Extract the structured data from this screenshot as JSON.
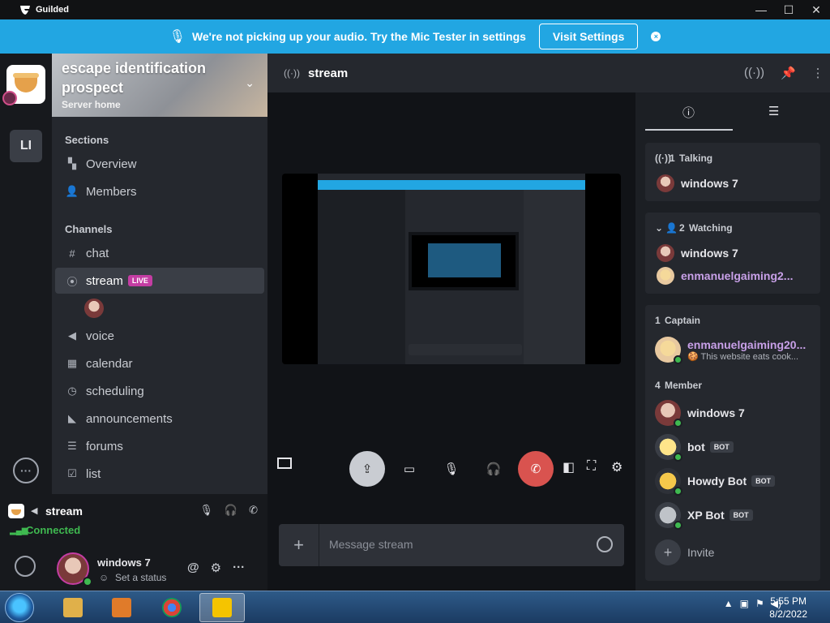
{
  "window": {
    "app_title": "Guilded",
    "minimize": "—",
    "maximize": "☐",
    "close": "✕"
  },
  "banner": {
    "message": "We're not picking up your audio. Try the Mic Tester in settings",
    "button": "Visit Settings",
    "close": "×"
  },
  "server": {
    "name": "escape identification prospect",
    "subtitle": "Server home",
    "rail_label": "LI"
  },
  "sidebar": {
    "sections_label": "Sections",
    "sections": [
      {
        "label": "Overview",
        "icon": "overview-icon"
      },
      {
        "label": "Members",
        "icon": "members-icon"
      }
    ],
    "channels_label": "Channels",
    "channels": [
      {
        "label": "chat",
        "icon": "hash-icon",
        "glyph": "#"
      },
      {
        "label": "stream",
        "icon": "stream-icon",
        "glyph": "((·))",
        "live": "LIVE"
      },
      {
        "label": "voice",
        "icon": "speaker-icon",
        "glyph": "🔈"
      },
      {
        "label": "calendar",
        "icon": "calendar-icon",
        "glyph": "▦"
      },
      {
        "label": "scheduling",
        "icon": "clock-icon",
        "glyph": "◷"
      },
      {
        "label": "announcements",
        "icon": "megaphone-icon",
        "glyph": "📢"
      },
      {
        "label": "forums",
        "icon": "forums-icon",
        "glyph": "☰"
      },
      {
        "label": "list",
        "icon": "checklist-icon",
        "glyph": "☑"
      }
    ]
  },
  "voice_panel": {
    "channel": "stream",
    "status": "Connected"
  },
  "user_panel": {
    "name": "windows 7",
    "status_placeholder": "Set a status"
  },
  "main": {
    "channel_title": "stream",
    "composer_placeholder": "Message stream",
    "plus": "+"
  },
  "right_panel": {
    "talking": {
      "count": "1",
      "label": "Talking",
      "members": [
        "windows 7"
      ]
    },
    "watching": {
      "count": "2",
      "label": "Watching",
      "members": [
        "windows 7",
        "enmanuelgaiming2..."
      ]
    },
    "captain": {
      "count": "1",
      "label": "Captain",
      "name": "enmanuelgaiming20...",
      "status": "🍪 This website eats cook..."
    },
    "member": {
      "count": "4",
      "label": "Member",
      "items": [
        {
          "name": "windows 7",
          "badge": ""
        },
        {
          "name": "bot",
          "badge": "BOT"
        },
        {
          "name": "Howdy Bot",
          "badge": "BOT"
        },
        {
          "name": "XP Bot",
          "badge": "BOT"
        }
      ]
    },
    "invite": "Invite"
  },
  "taskbar": {
    "time": "5:55 PM",
    "date": "8/2/2022"
  },
  "colors": {
    "banner": "#22a6e2",
    "live": "#c43da3",
    "connected": "#3fb950",
    "end_call": "#d9534f"
  }
}
